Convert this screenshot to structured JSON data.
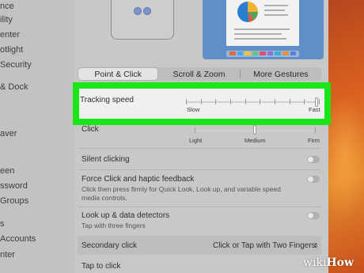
{
  "sidebar": {
    "items": [
      {
        "label": "nce"
      },
      {
        "label": "ility"
      },
      {
        "label": "enter"
      },
      {
        "label": "otlight"
      },
      {
        "label": "Security"
      },
      {
        "label": "& Dock"
      },
      {
        "label": "aver"
      },
      {
        "label": "een"
      },
      {
        "label": "ssword"
      },
      {
        "label": "Groups"
      },
      {
        "label": "s"
      },
      {
        "label": "Accounts"
      },
      {
        "label": "nter"
      }
    ]
  },
  "tabs": [
    {
      "label": "Point & Click",
      "active": true
    },
    {
      "label": "Scroll & Zoom",
      "active": false
    },
    {
      "label": "More Gestures",
      "active": false
    }
  ],
  "tracking": {
    "label": "Tracking speed",
    "min_label": "Slow",
    "max_label": "Fast",
    "value_fraction": 0.98
  },
  "click": {
    "label": "Click",
    "options": [
      "Light",
      "Medium",
      "Firm"
    ],
    "value_fraction": 0.5
  },
  "settings": {
    "silent_clicking": {
      "label": "Silent clicking",
      "on": false
    },
    "force_click": {
      "label": "Force Click and haptic feedback",
      "desc_line1": "Click then press firmly for Quick Look, Look up, and variable speed",
      "desc_line2": "media controls.",
      "on": false
    },
    "lookup": {
      "label": "Look up & data detectors",
      "desc": "Tap with three fingers",
      "on": false
    },
    "secondary": {
      "label": "Secondary click",
      "value": "Click or Tap with Two Fingers"
    },
    "tap": {
      "label": "Tap to click"
    }
  },
  "watermark": {
    "prefix": "wiki",
    "suffix": "How"
  },
  "colors": {
    "highlight": "#19e619",
    "wallpaper": "#d9601f"
  }
}
